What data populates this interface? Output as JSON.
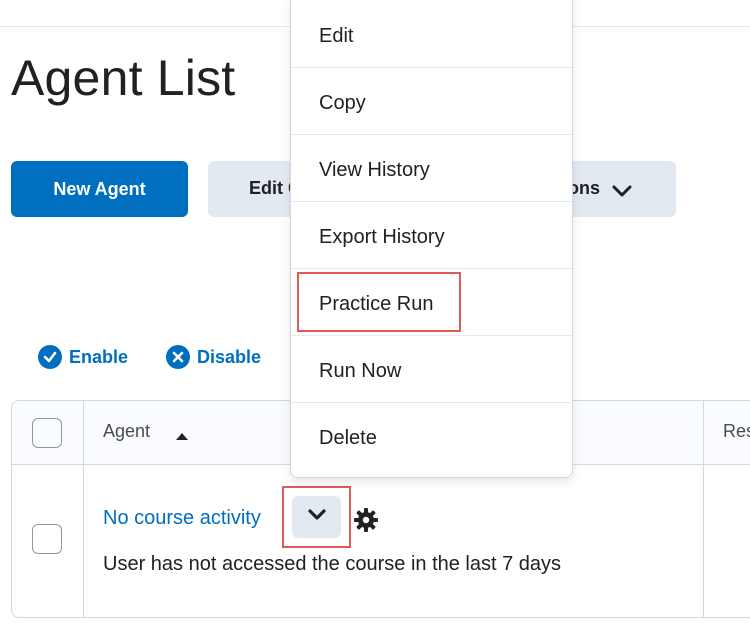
{
  "page": {
    "title": "Agent List"
  },
  "toolbar": {
    "new_agent_label": "New Agent",
    "edit_label_partial": "Edit C",
    "more_actions_partial": "ons"
  },
  "actions": {
    "enable_label": "Enable",
    "disable_label": "Disable"
  },
  "table": {
    "headers": {
      "agent": "Agent",
      "res_partial": "Res"
    },
    "rows": [
      {
        "name": "No course activity",
        "description": "User has not accessed the course in the last 7 days"
      }
    ]
  },
  "menu": {
    "items": [
      {
        "label": "Edit"
      },
      {
        "label": "Copy"
      },
      {
        "label": "View History"
      },
      {
        "label": "Export History"
      },
      {
        "label": "Practice Run",
        "highlighted": true
      },
      {
        "label": "Run Now"
      },
      {
        "label": "Delete"
      }
    ]
  },
  "icons": {
    "enable": "check-circle-icon",
    "disable": "x-circle-icon",
    "sort": "sort-ascending-icon",
    "dropdown": "chevron-down-icon",
    "settings": "gear-icon"
  },
  "colors": {
    "primary": "#006fbf",
    "highlight_border": "#e05a5a",
    "secondary_bg": "#e3e9f1"
  }
}
